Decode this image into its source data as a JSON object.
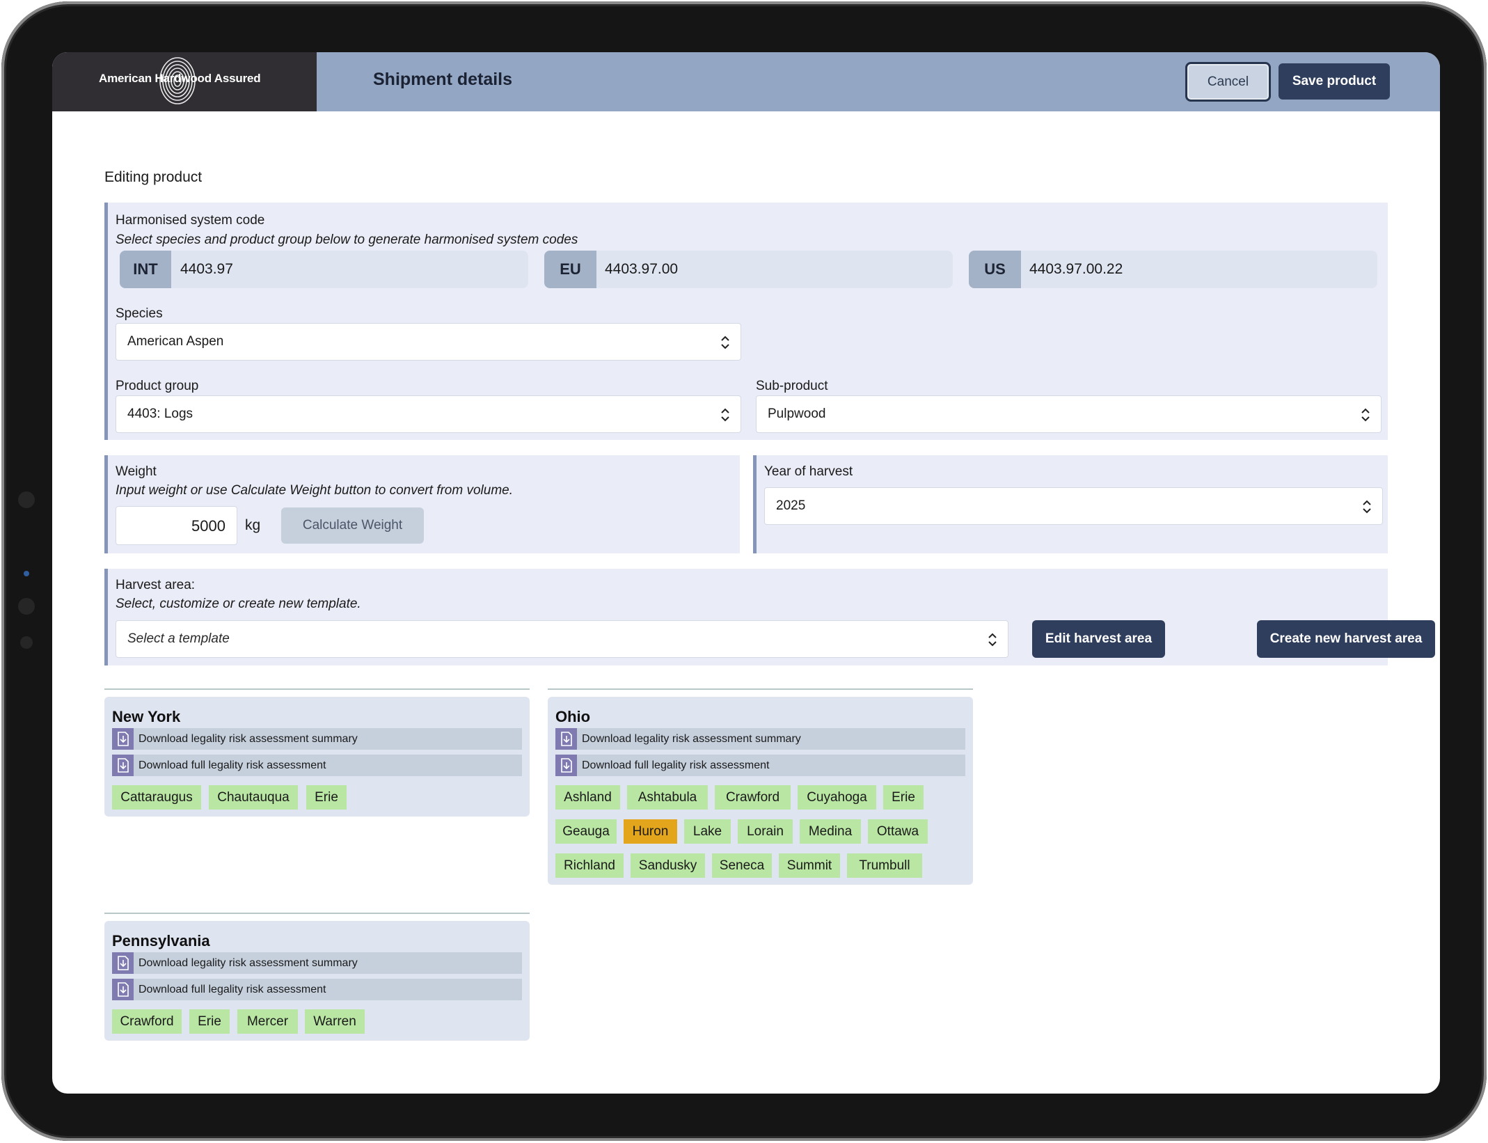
{
  "header": {
    "logo_text": "American Hardwood Assured",
    "title": "Shipment details",
    "cancel_label": "Cancel",
    "save_label": "Save product"
  },
  "form": {
    "section_title": "Editing product",
    "hs": {
      "label": "Harmonised system code",
      "hint": "Select species and product group below to generate harmonised system codes",
      "codes": [
        {
          "tag": "INT",
          "value": "4403.97"
        },
        {
          "tag": "EU",
          "value": "4403.97.00"
        },
        {
          "tag": "US",
          "value": "4403.97.00.22"
        }
      ]
    },
    "species": {
      "label": "Species",
      "value": "American Aspen"
    },
    "product_group": {
      "label": "Product group",
      "value": "4403: Logs"
    },
    "sub_product": {
      "label": "Sub-product",
      "value": "Pulpwood"
    },
    "weight": {
      "label": "Weight",
      "hint": "Input weight or use Calculate Weight button to convert from volume.",
      "value": "5000",
      "unit": "kg",
      "calc_label": "Calculate Weight"
    },
    "year": {
      "label": "Year of harvest",
      "value": "2025"
    },
    "harvest_area": {
      "label": "Harvest area:",
      "hint": "Select, customize or create new template.",
      "placeholder": "Select a template",
      "edit_label": "Edit harvest area",
      "create_label": "Create new harvest area"
    }
  },
  "regions": [
    {
      "name": "New York",
      "downloads": [
        "Download legality risk assessment summary",
        "Download full legality risk assessment"
      ],
      "counties": [
        "Cattaraugus",
        "Chautauqua",
        "Erie"
      ]
    },
    {
      "name": "Ohio",
      "downloads": [
        "Download legality risk assessment summary",
        "Download full legality risk assessment"
      ],
      "counties": [
        "Ashland",
        "Ashtabula",
        "Crawford",
        "Cuyahoga",
        "Erie",
        "Geauga",
        "Huron",
        "Lake",
        "Lorain",
        "Medina",
        "Ottawa",
        "Richland",
        "Sandusky",
        "Seneca",
        "Summit",
        "Trumbull"
      ]
    },
    {
      "name": "Pennsylvania",
      "downloads": [
        "Download legality risk assessment summary",
        "Download full legality risk assessment"
      ],
      "counties": [
        "Crawford",
        "Erie",
        "Mercer",
        "Warren"
      ]
    }
  ],
  "colors": {
    "header_bg": "#93a6c3",
    "logo_bg": "#302e33",
    "primary_button": "#2e3e5c",
    "panel_bg": "#eaedf7",
    "county_ok": "#b9e6a3",
    "county_warning": "#e3a51c"
  }
}
